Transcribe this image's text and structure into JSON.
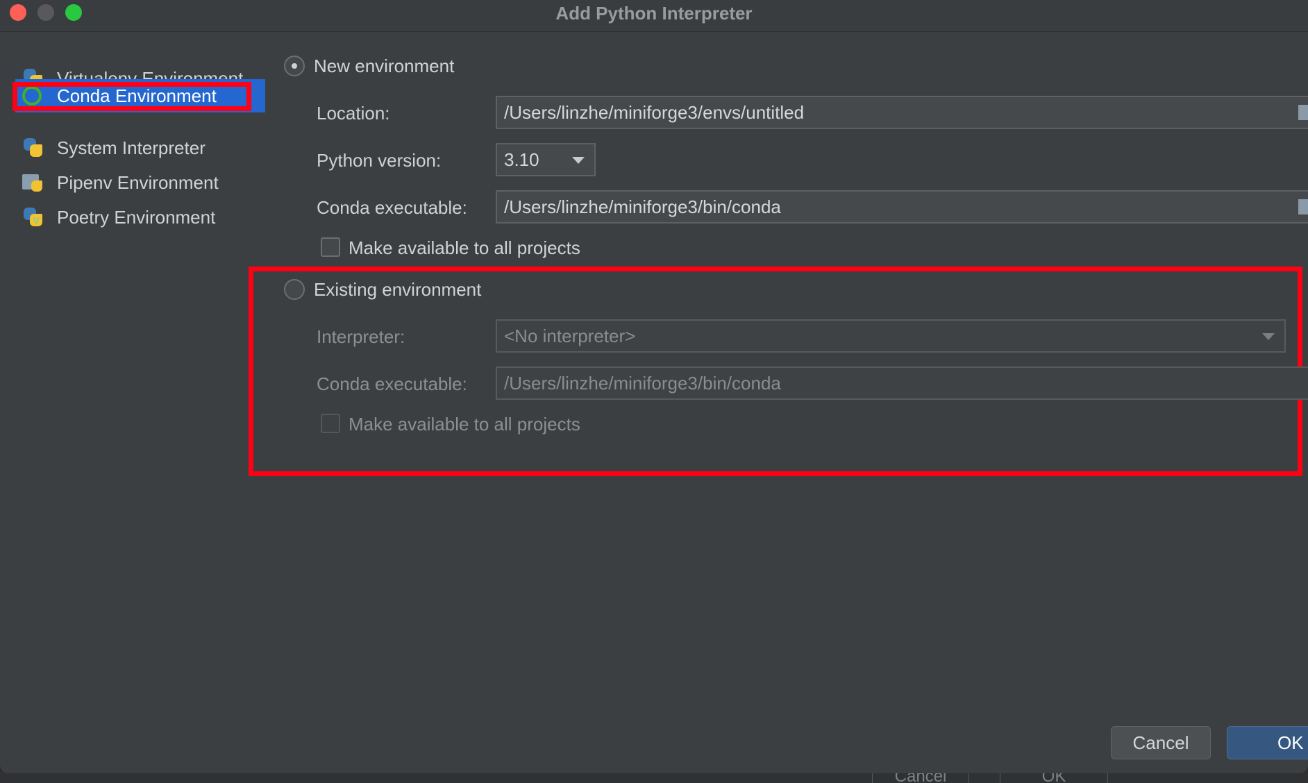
{
  "window": {
    "title": "Add Python Interpreter",
    "controls": [
      "close",
      "minimize",
      "maximize"
    ]
  },
  "sidebar": {
    "items": [
      {
        "label": "Virtualenv Environment",
        "icon": "python-virtualenv-icon",
        "selected": false
      },
      {
        "label": "Conda Environment",
        "icon": "conda-icon",
        "selected": true
      },
      {
        "label": "System Interpreter",
        "icon": "python-icon",
        "selected": false
      },
      {
        "label": "Pipenv Environment",
        "icon": "pipenv-icon",
        "selected": false
      },
      {
        "label": "Poetry Environment",
        "icon": "poetry-icon",
        "selected": false
      }
    ]
  },
  "new_env": {
    "radio_label": "New environment",
    "selected": true,
    "location_label": "Location:",
    "location_value": "/Users/linzhe/miniforge3/envs/untitled",
    "python_version_label": "Python version:",
    "python_version_value": "3.10",
    "conda_exec_label": "Conda executable:",
    "conda_exec_value": "/Users/linzhe/miniforge3/bin/conda",
    "make_available_label": "Make available to all projects",
    "make_available_checked": false
  },
  "existing_env": {
    "radio_label": "Existing environment",
    "selected": false,
    "interpreter_label": "Interpreter:",
    "interpreter_value": "<No interpreter>",
    "conda_exec_label": "Conda executable:",
    "conda_exec_value": "/Users/linzhe/miniforge3/bin/conda",
    "make_available_label": "Make available to all projects",
    "make_available_checked": false
  },
  "footer": {
    "cancel_label": "Cancel",
    "ok_label": "OK"
  },
  "background": {
    "ghost_cancel": "Cancel",
    "ghost_ok": "OK"
  },
  "colors": {
    "selection": "#2467d1",
    "annotation": "#ff0014",
    "ok_button": "#365880"
  }
}
